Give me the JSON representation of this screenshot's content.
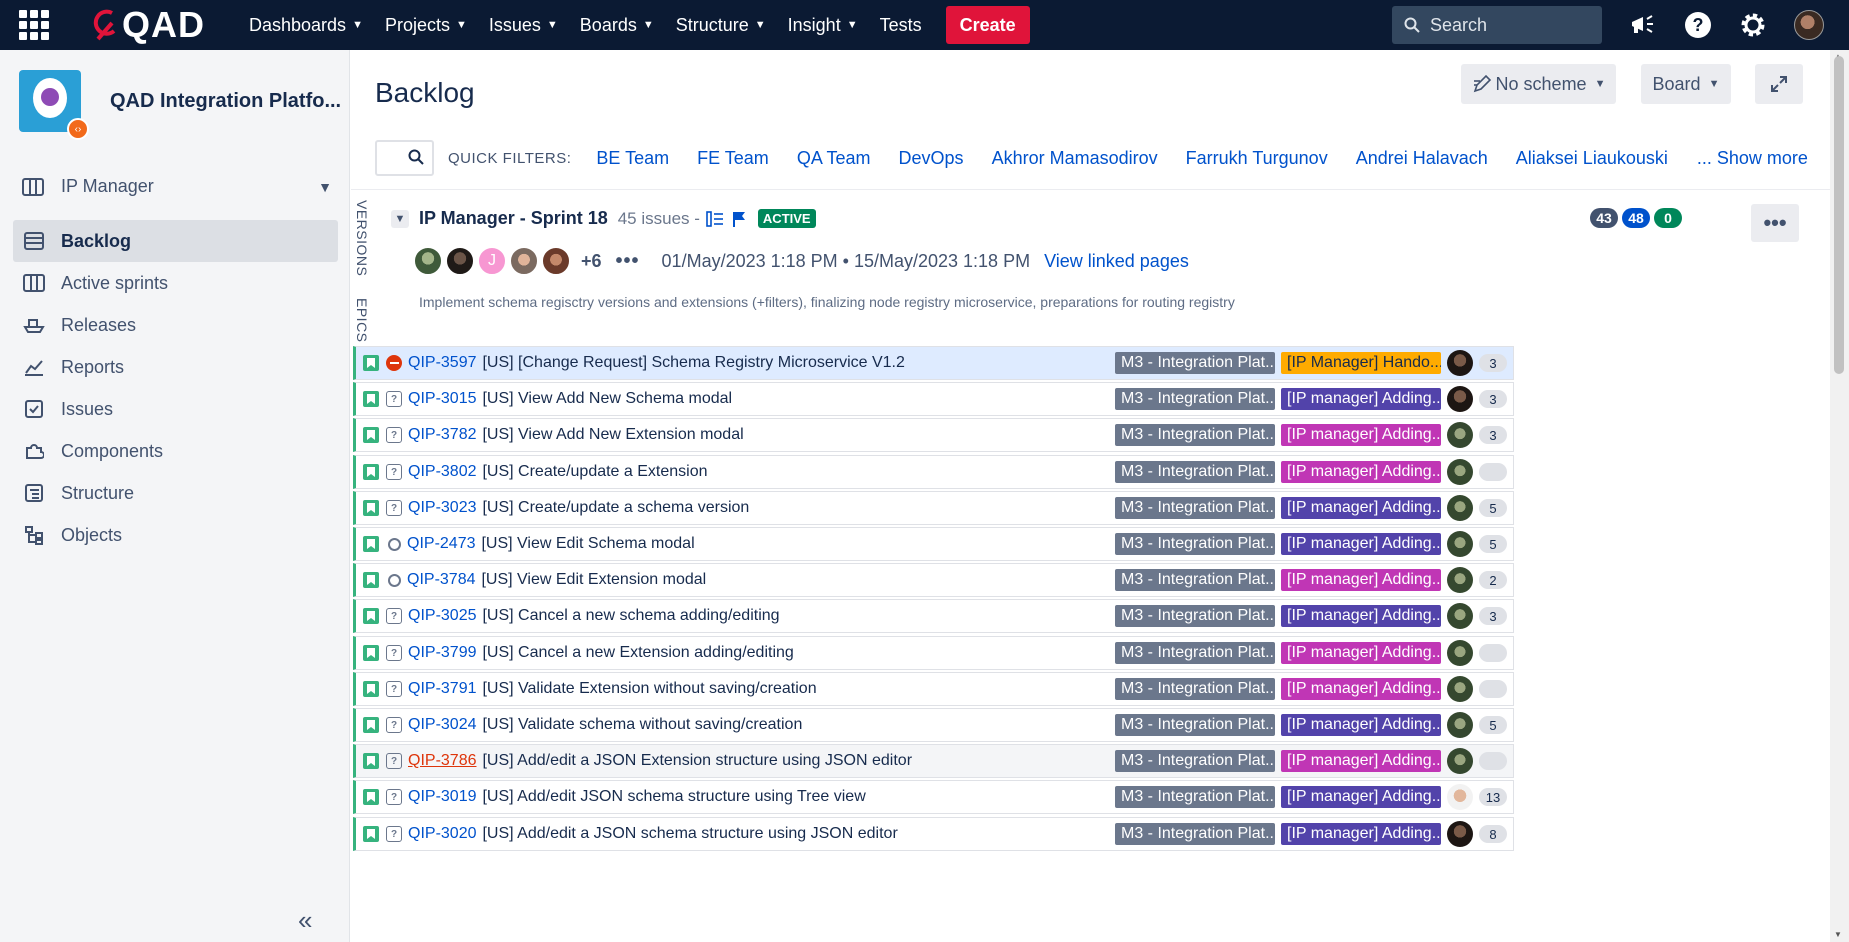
{
  "topnav": {
    "logo": "QAD",
    "items": [
      {
        "label": "Dashboards",
        "dropdown": true
      },
      {
        "label": "Projects",
        "dropdown": true
      },
      {
        "label": "Issues",
        "dropdown": true
      },
      {
        "label": "Boards",
        "dropdown": true
      },
      {
        "label": "Structure",
        "dropdown": true
      },
      {
        "label": "Insight",
        "dropdown": true
      },
      {
        "label": "Tests",
        "dropdown": false
      }
    ],
    "create_label": "Create",
    "search_placeholder": "Search"
  },
  "sidebar": {
    "project_name": "QAD Integration Platfo...",
    "section_label": "IP Manager",
    "items": [
      {
        "label": "Backlog",
        "icon": "backlog-icon",
        "active": true
      },
      {
        "label": "Active sprints",
        "icon": "board-icon",
        "active": false
      },
      {
        "label": "Releases",
        "icon": "ship-icon",
        "active": false
      },
      {
        "label": "Reports",
        "icon": "chart-icon",
        "active": false
      },
      {
        "label": "Issues",
        "icon": "issues-icon",
        "active": false
      },
      {
        "label": "Components",
        "icon": "puzzle-icon",
        "active": false
      },
      {
        "label": "Structure",
        "icon": "structure-icon",
        "active": false
      },
      {
        "label": "Objects",
        "icon": "objects-icon",
        "active": false
      }
    ],
    "collapse_label": "«"
  },
  "main": {
    "title": "Backlog",
    "scheme_label": "No scheme",
    "board_label": "Board",
    "quick_filters_label": "QUICK FILTERS:",
    "quick_filters": [
      "BE Team",
      "FE Team",
      "QA Team",
      "DevOps",
      "Akhror Mamasodirov",
      "Farrukh Turgunov",
      "Andrei Halavach",
      "Aliaksei Liaukouski"
    ],
    "show_more": "... Show more",
    "vertical_tabs": [
      "VERSIONS",
      "EPICS"
    ]
  },
  "sprint": {
    "name": "IP Manager - Sprint 18",
    "issue_count": "45 issues -",
    "status": "ACTIVE",
    "counts": [
      {
        "value": "43",
        "color": "#42526e"
      },
      {
        "value": "48",
        "color": "#0052cc"
      },
      {
        "value": "0",
        "color": "#00875a"
      }
    ],
    "extra_members": "+6",
    "member_initial": "J",
    "dates": "01/May/2023 1:18 PM • 15/May/2023 1:18 PM",
    "linked_label": "View linked pages",
    "goal": "Implement schema regisctry versions and extensions (+filters), finalizing node registry microservice, preparations for routing registry"
  },
  "colors": {
    "epic_gold": "#ffab00",
    "epic_pink": "#c036b5",
    "epic_purple": "#5243aa",
    "version_gray": "#6b778c",
    "story_green": "#36b37e"
  },
  "issues": [
    {
      "key": "QIP-3597",
      "summary": "[US] [Change Request] Schema Registry Microservice V1.2",
      "version": "M3 - Integration Plat...",
      "epic": "[IP Manager] Hando...",
      "epic_color": "gold",
      "priority": "blocker",
      "points": "3",
      "avatar": "dark"
    },
    {
      "key": "QIP-3015",
      "summary": "[US] View Add New Schema modal",
      "version": "M3 - Integration Plat...",
      "epic": "[IP manager] Adding...",
      "epic_color": "purple",
      "priority": "unknown",
      "points": "3",
      "avatar": "dark"
    },
    {
      "key": "QIP-3782",
      "summary": "[US] View Add New Extension modal",
      "version": "M3 - Integration Plat...",
      "epic": "[IP manager] Adding...",
      "epic_color": "pink",
      "priority": "unknown",
      "points": "3",
      "avatar": "outdoor"
    },
    {
      "key": "QIP-3802",
      "summary": "[US] Create/update a Extension",
      "version": "M3 - Integration Plat...",
      "epic": "[IP manager] Adding...",
      "epic_color": "pink",
      "priority": "unknown",
      "points": "",
      "avatar": "outdoor"
    },
    {
      "key": "QIP-3023",
      "summary": "[US] Create/update a schema version",
      "version": "M3 - Integration Plat...",
      "epic": "[IP manager] Adding...",
      "epic_color": "purple",
      "priority": "unknown",
      "points": "5",
      "avatar": "outdoor"
    },
    {
      "key": "QIP-2473",
      "summary": "[US] View Edit Schema modal",
      "version": "M3 - Integration Plat...",
      "epic": "[IP manager] Adding...",
      "epic_color": "purple",
      "priority": "ring",
      "points": "5",
      "avatar": "outdoor"
    },
    {
      "key": "QIP-3784",
      "summary": "[US] View Edit Extension modal",
      "version": "M3 - Integration Plat...",
      "epic": "[IP manager] Adding...",
      "epic_color": "pink",
      "priority": "ring",
      "points": "2",
      "avatar": "outdoor"
    },
    {
      "key": "QIP-3025",
      "summary": "[US] Cancel a new schema adding/editing",
      "version": "M3 - Integration Plat...",
      "epic": "[IP manager] Adding...",
      "epic_color": "purple",
      "priority": "unknown",
      "points": "3",
      "avatar": "outdoor"
    },
    {
      "key": "QIP-3799",
      "summary": "[US] Cancel a new Extension adding/editing",
      "version": "M3 - Integration Plat...",
      "epic": "[IP manager] Adding...",
      "epic_color": "pink",
      "priority": "unknown",
      "points": "",
      "avatar": "outdoor"
    },
    {
      "key": "QIP-3791",
      "summary": "[US] Validate Extension without saving/creation",
      "version": "M3 - Integration Plat...",
      "epic": "[IP manager] Adding...",
      "epic_color": "pink",
      "priority": "unknown",
      "points": "",
      "avatar": "outdoor"
    },
    {
      "key": "QIP-3024",
      "summary": "[US] Validate schema without saving/creation",
      "version": "M3 - Integration Plat...",
      "epic": "[IP manager] Adding...",
      "epic_color": "purple",
      "priority": "unknown",
      "points": "5",
      "avatar": "outdoor"
    },
    {
      "key": "QIP-3786",
      "summary": "[US] Add/edit a JSON Extension structure using JSON editor",
      "version": "M3 - Integration Plat...",
      "epic": "[IP manager] Adding...",
      "epic_color": "pink",
      "priority": "unknown",
      "points": "",
      "avatar": "outdoor",
      "hover": true
    },
    {
      "key": "QIP-3019",
      "summary": "[US] Add/edit JSON schema structure using Tree view",
      "version": "M3 - Integration Plat...",
      "epic": "[IP manager] Adding...",
      "epic_color": "purple",
      "priority": "unknown",
      "points": "13",
      "avatar": "light"
    },
    {
      "key": "QIP-3020",
      "summary": "[US] Add/edit a JSON schema structure using JSON editor",
      "version": "M3 - Integration Plat...",
      "epic": "[IP manager] Adding...",
      "epic_color": "purple",
      "priority": "unknown",
      "points": "8",
      "avatar": "dark"
    }
  ]
}
